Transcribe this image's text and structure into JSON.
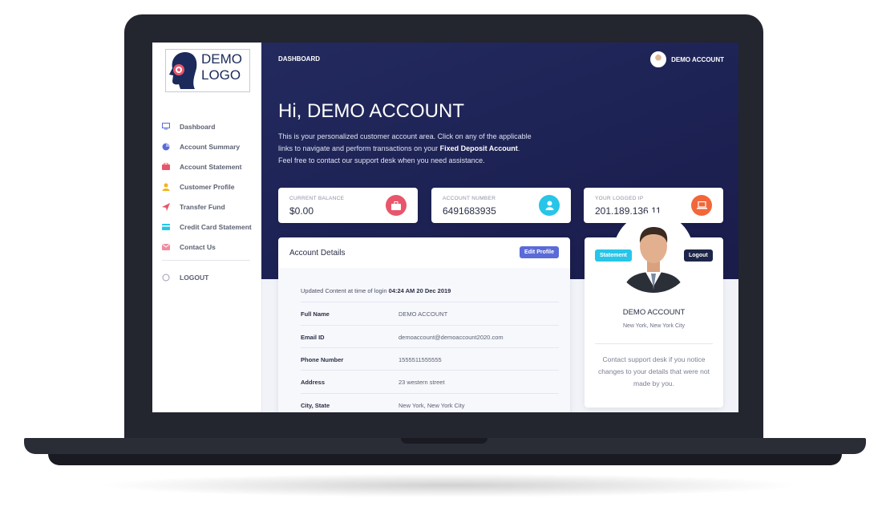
{
  "sidebar": {
    "logo_line1": "DEMO",
    "logo_line2": "LOGO",
    "items": [
      {
        "label": "Dashboard",
        "icon": "monitor-icon",
        "color": "#5a6bd8"
      },
      {
        "label": "Account Summary",
        "icon": "pie-chart-icon",
        "color": "#5a6bd8"
      },
      {
        "label": "Account Statement",
        "icon": "briefcase-icon",
        "color": "#e8566b"
      },
      {
        "label": "Customer Profile",
        "icon": "user-icon",
        "color": "#f2b31c"
      },
      {
        "label": "Transfer Fund",
        "icon": "send-icon",
        "color": "#e8566b"
      },
      {
        "label": "Credit Card Statement",
        "icon": "credit-card-icon",
        "color": "#27c5e8"
      },
      {
        "label": "Contact Us",
        "icon": "mail-icon",
        "color": "#f28aa0"
      }
    ],
    "logout_label": "LOGOUT"
  },
  "header": {
    "title": "DASHBOARD",
    "user_name": "DEMO ACCOUNT"
  },
  "hero": {
    "greeting": "Hi, DEMO ACCOUNT",
    "intro_part1": "This is your personalized customer account area. Click on any of the applicable links to navigate and perform transactions on your ",
    "intro_bold": "Fixed Deposit Account",
    "intro_part2": ". Feel free to contact our support desk when you need assistance."
  },
  "stats": [
    {
      "label": "CURRENT BALANCE",
      "value": "$0.00",
      "icon": "briefcase-icon",
      "color": "#e8566b"
    },
    {
      "label": "ACCOUNT NUMBER",
      "value": "6491683935",
      "icon": "user-icon",
      "color": "#27c5e8"
    },
    {
      "label": "YOUR LOGGED IP",
      "value": "201.189.136.11",
      "icon": "laptop-icon",
      "color": "#f2673a"
    }
  ],
  "details": {
    "title": "Account Details",
    "edit_label": "Edit Profile",
    "updated_prefix": "Updated Content at time of login ",
    "updated_time": "04:24 AM 20 Dec 2019",
    "rows": [
      {
        "key": "Full Name",
        "value": "DEMO ACCOUNT"
      },
      {
        "key": "Email ID",
        "value": "demoaccount@demoaccount2020.com"
      },
      {
        "key": "Phone Number",
        "value": "1555511555555"
      },
      {
        "key": "Address",
        "value": "23 western street"
      },
      {
        "key": "City, State",
        "value": "New York, New York City"
      }
    ]
  },
  "profile": {
    "statement_label": "Statement",
    "logout_label": "Logout",
    "name": "DEMO ACCOUNT",
    "location": "New York, New York City",
    "note": "Contact support desk if you notice changes to your details that were not made by you."
  }
}
